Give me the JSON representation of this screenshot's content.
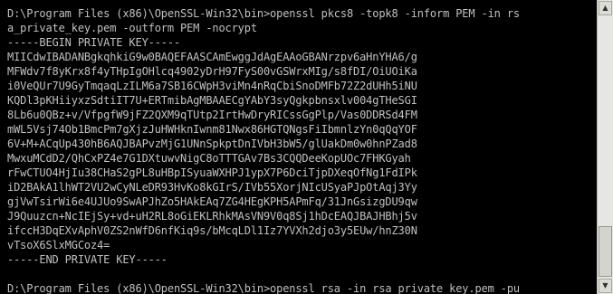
{
  "console": {
    "lines": [
      "D:\\Program Files (x86)\\OpenSSL-Win32\\bin>openssl pkcs8 -topk8 -inform PEM -in rs",
      "a_private_key.pem -outform PEM -nocrypt",
      "-----BEGIN PRIVATE KEY-----",
      "MIICdwIBADANBgkqhkiG9w0BAQEFAASCAmEwggJdAgEAAoGBANrzpv6aHnYHA6/g",
      "MFWdv7f8yKrx8f4yTHpIgOHlcq4902yDrH97FyS00vGSWrxMIg/s8fDI/OiUOiKa",
      "i0VeQUr7U9GyTmqaqLzILM6a7SB16CWpH3viMn4nRqCbiSnoDMFb72Z2dUHh5iNU",
      "KQDl3pKHiiyxzSdtiIT7U+ERTmibAgMBAAECgYAbY3syQgkpbnsxlv004gTHeSGI",
      "8Lb6u0QBz+v/VfpgfW9jFZ2QXM9qTUtp2IrtHwDryRICssGgPlp/Vas0DDRSd4FM",
      "mWL5Vsj74Ob1BmcPm7gXjzJuHWHknIwnm81Nwx86HGTQNgsFiIbmnlzYn0qQqYOF",
      "6V+M+ACqUp430hB6AQJBAPvzMjG1UNnSpkptDnIVbH3bW5/glUakDm0w0hnPZad8",
      "MwxuMCdD2/QhCxPZ4e7G1DXtuwvNigC8oTTTGAv7Bs3CQQDeeKopUOc7FHKGyah",
      "rFwCTUO4HjIu38CHaS2gPL8uHBpISyuaWXHPJ1ypX7P6DciTjpDXeqOfNg1FdIPk",
      "iD2BAkA1lhWT2VU2wCyNLeDR93HvKo8kGIrS/IVb55XorjNIcUSyaPJpOtAqj3Yy",
      "gjVwTsirWi6e4UJUo9SwAPJhZo5HAkEAq7ZG4HEgKPH5APmFq/31JnGsizgDU9qw",
      "J9Quuzcn+NcIEjSy+vd+uH2RL8oGiEKLRhkMAsVN9V0q8Sj1hDcEAQJBAJHBhj5v",
      "ifccH3DqEXvAphV0ZS2nWfD6nfKiq9s/bMcqLDl1Iz7YVXh2djo3y5EUw/hnZ30N",
      "vTsoX6SlxMGCoz4=",
      "-----END PRIVATE KEY-----",
      "",
      "D:\\Program Files (x86)\\OpenSSL-Win32\\bin>openssl rsa -in rsa_private_key.pem -pu"
    ]
  },
  "colors": {
    "background": "#000000",
    "text": "#c0c0c0",
    "scrollbar_track": "#e6e6e2"
  },
  "scrollbar": {
    "up_icon": "▲",
    "down_icon": "▼"
  }
}
